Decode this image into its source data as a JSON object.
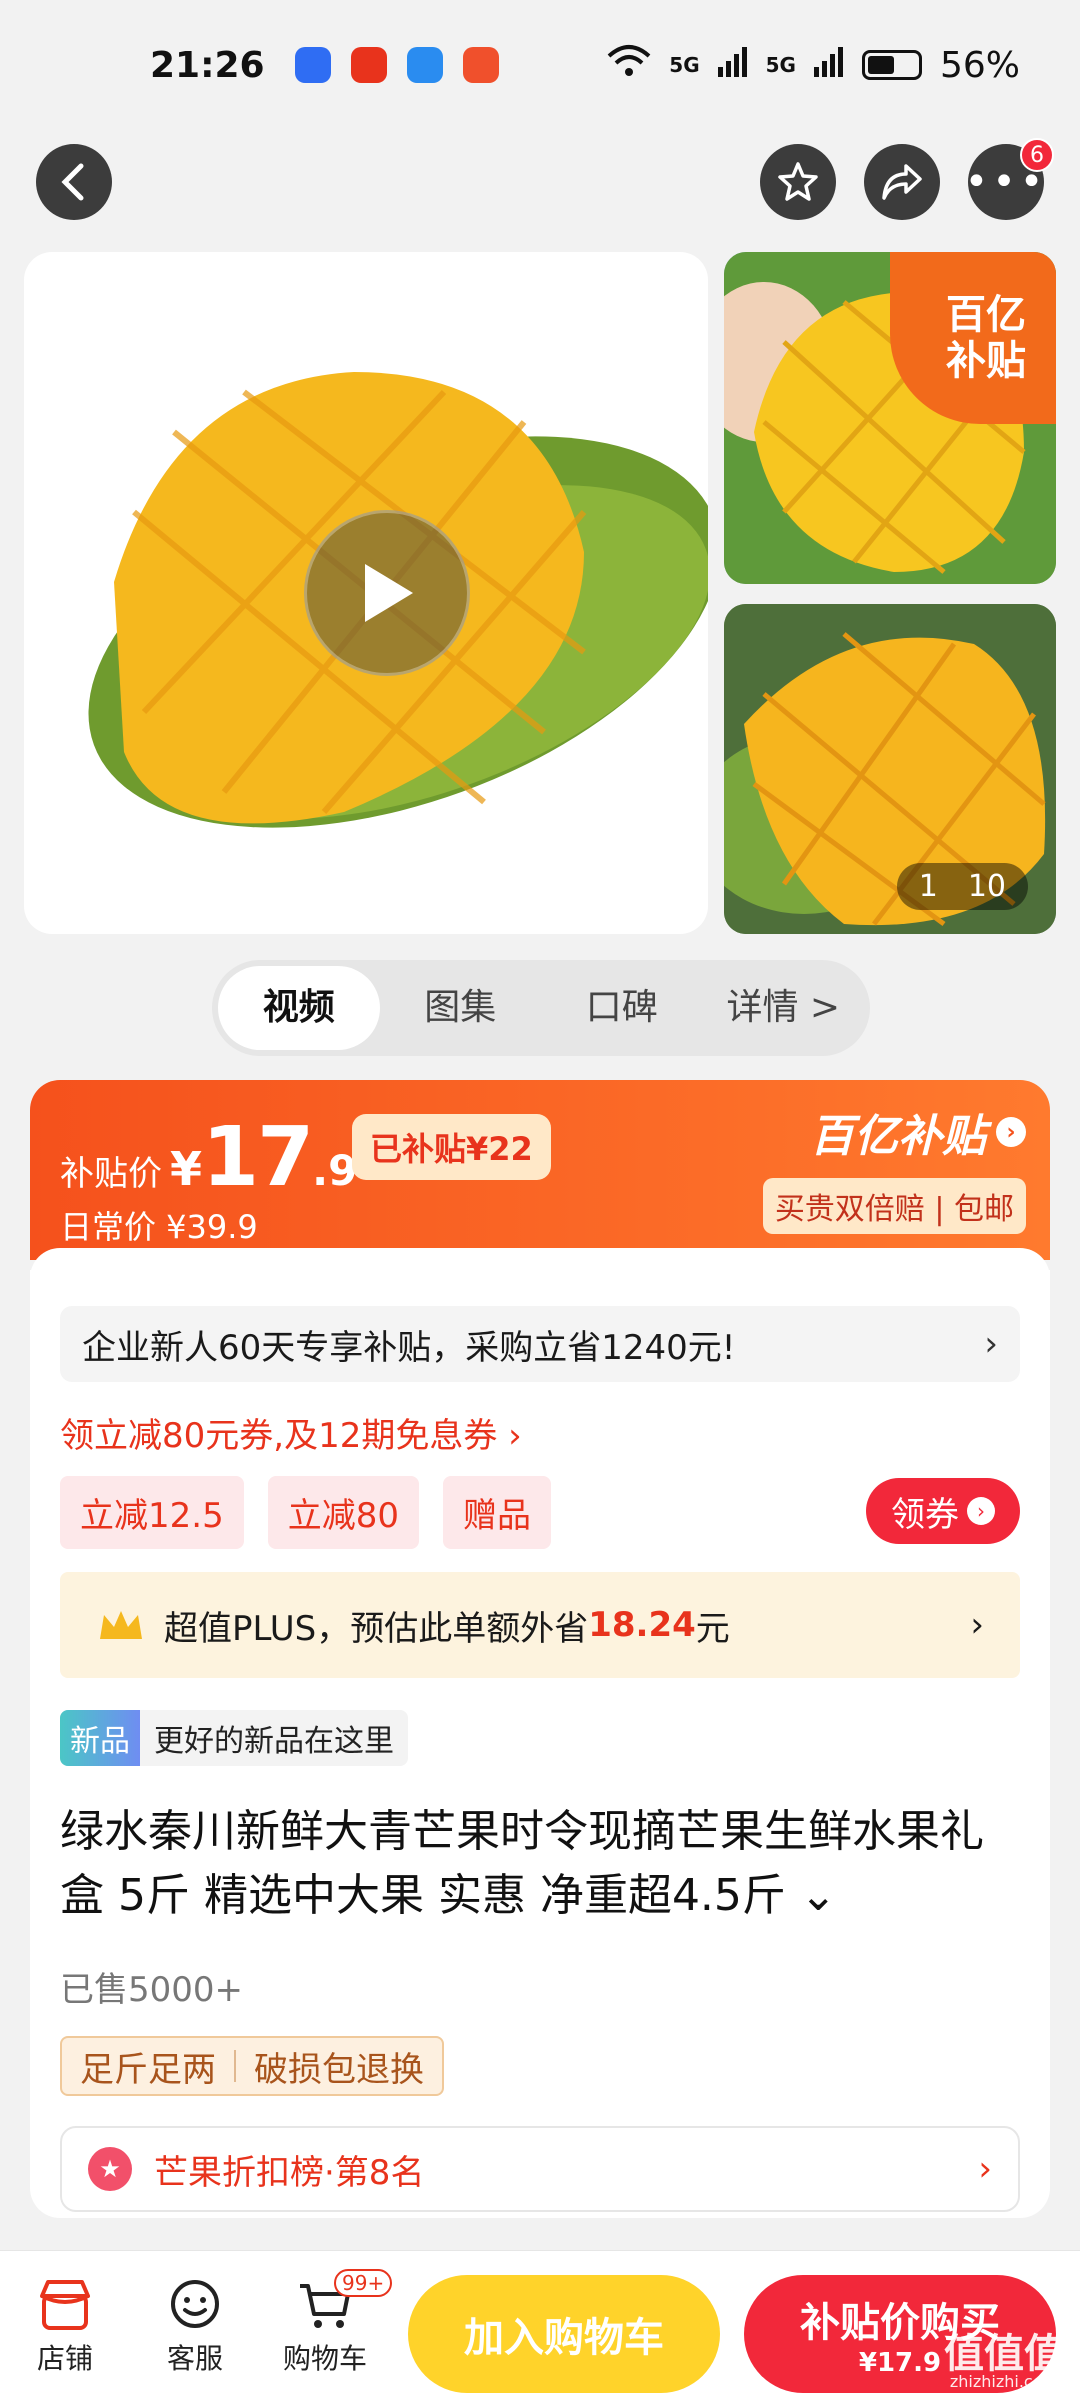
{
  "status_bar": {
    "time": "21:26",
    "network": "5G",
    "battery": "56%"
  },
  "header": {
    "cart_badge_count": "6"
  },
  "gallery": {
    "subsidy_badge_line1": "百亿",
    "subsidy_badge_line2": "补贴",
    "counter_current": "1",
    "counter_total": "10"
  },
  "tabs": [
    "视频",
    "图集",
    "口碑",
    "详情 >"
  ],
  "price": {
    "label": "补贴价",
    "yen": "¥",
    "int": "17",
    "dec": ".9",
    "subsidized": "已补贴¥22",
    "daily": "日常价 ¥39.9",
    "brand_title": "百亿补贴",
    "brand_sub": "买贵双倍赔 | 包邮"
  },
  "promo": {
    "enterprise": "企业新人60天专享补贴，采购立省1240元!",
    "coupon_line": "领立减80元券,及12期免息券 ›",
    "chips": [
      "立减12.5",
      "立减80",
      "赠品"
    ],
    "get_coupon": "领券",
    "plus_prefix": "超值PLUS，预估此单额外省",
    "plus_amount": "18.24",
    "plus_suffix": "元"
  },
  "product": {
    "new_tag": "新品",
    "new_desc": "更好的新品在这里",
    "title": "绿水秦川新鲜大青芒果时令现摘芒果生鲜水果礼盒 5斤 精选中大果 实惠 净重超4.5斤 ⌄",
    "sold": "已售5000+",
    "guarantee": [
      "足斤足两",
      "破损包退换"
    ],
    "rank": "芒果折扣榜·第8名"
  },
  "bottom_bar": {
    "store": "店铺",
    "service": "客服",
    "cart": "购物车",
    "cart_badge": "99+",
    "add_to_cart": "加入购物车",
    "buy_line1": "补贴价购买",
    "buy_line2": "¥17.9",
    "watermark": "值值值",
    "watermark_url": "zhizhizhi.com"
  },
  "colors": {
    "accent_red": "#f2283a",
    "subsidy_orange": "#f5511c",
    "cart_yellow": "#ffd32a"
  }
}
